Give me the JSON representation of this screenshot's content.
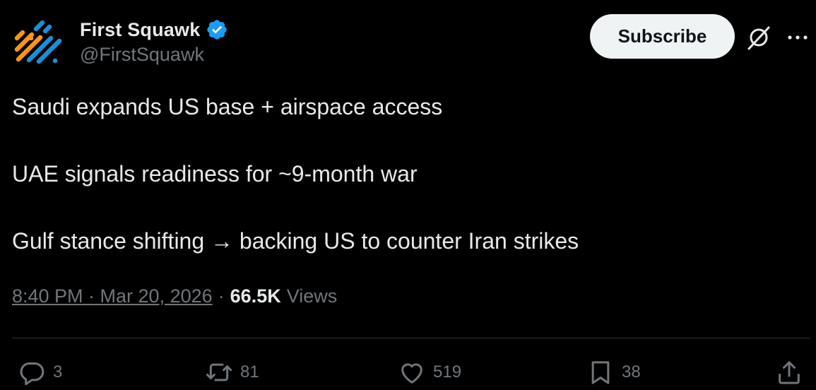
{
  "author": {
    "display_name": "First Squawk",
    "handle": "@FirstSquawk",
    "verified": true,
    "avatar_icon": "first-squawk-logo-icon"
  },
  "header": {
    "subscribe_label": "Subscribe",
    "grok_icon": "grok-icon",
    "more_icon": "more-options-icon"
  },
  "tweet": {
    "lines": [
      "Saudi expands US base + airspace access",
      "UAE signals readiness for ~9-month war",
      "Gulf stance shifting → backing US to counter Iran strikes"
    ]
  },
  "meta": {
    "timestamp": "8:40 PM · Mar 20, 2026",
    "separator": "·",
    "views_count": "66.5K",
    "views_label": "Views"
  },
  "actions": {
    "reply_count": "3",
    "repost_count": "81",
    "like_count": "519",
    "bookmark_count": "38"
  },
  "colors": {
    "background": "#000000",
    "primary_text": "#e7e9ea",
    "secondary_text": "#71767b",
    "verified_blue": "#1d9bf0",
    "logo_orange": "#f7941d",
    "logo_blue": "#1a8fd6",
    "divider": "#2f3336"
  }
}
